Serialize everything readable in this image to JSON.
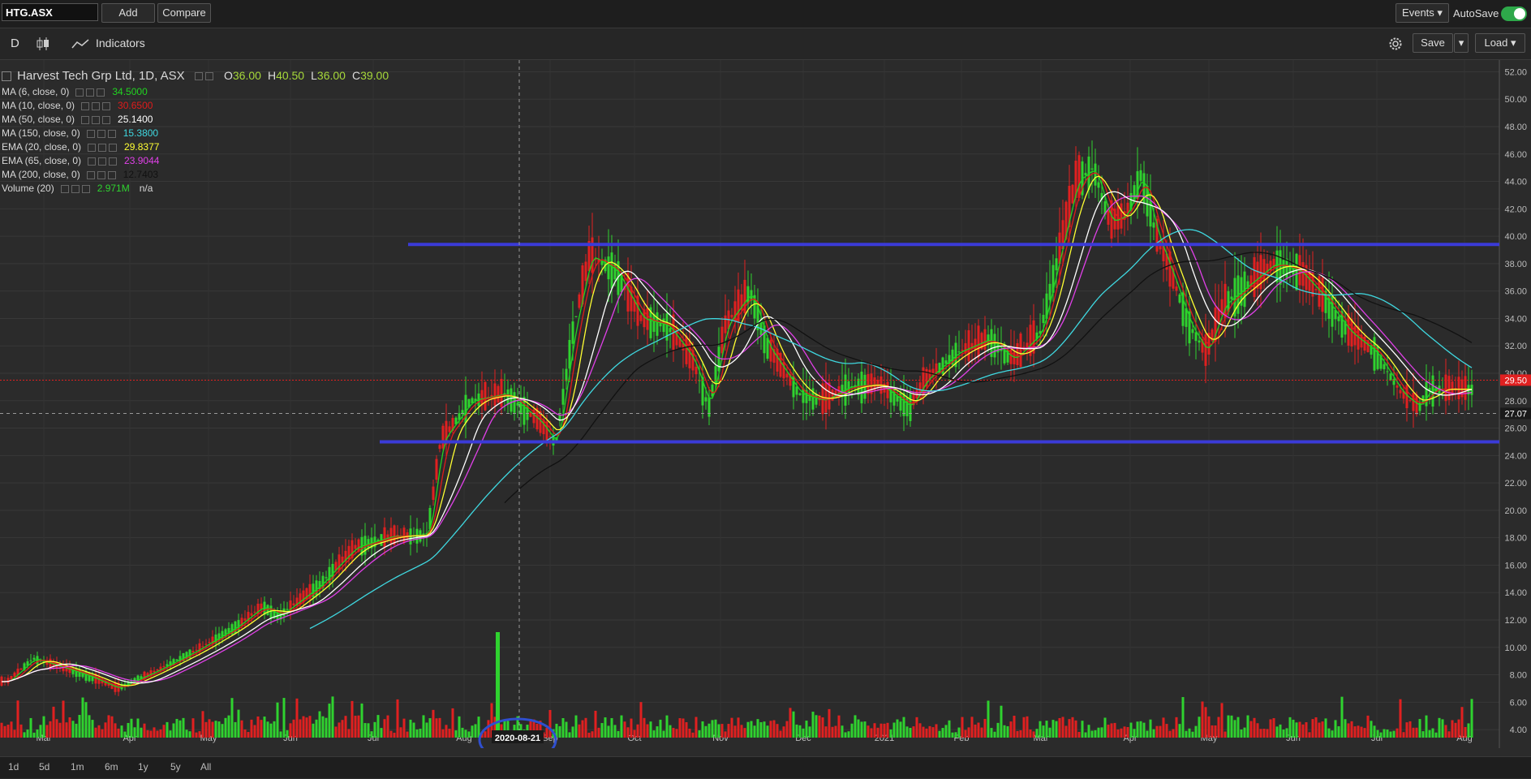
{
  "topbar": {
    "symbol": "HTG.ASX",
    "add_label": "Add",
    "compare_label": "Compare",
    "events_label": "Events ▾",
    "autosave_label": "AutoSave"
  },
  "toolbar": {
    "period_label": "D",
    "indicators_label": "Indicators",
    "save_label": "Save",
    "load_label": "Load ▾"
  },
  "legend": {
    "title": "Harvest Tech Grp Ltd, 1D, ASX",
    "ohlc": [
      {
        "label": "O",
        "value": "36.00"
      },
      {
        "label": "H",
        "value": "40.50"
      },
      {
        "label": "L",
        "value": "36.00"
      },
      {
        "label": "C",
        "value": "39.00"
      }
    ],
    "indicators": [
      {
        "label": "MA (6, close, 0)",
        "value": "34.5000",
        "color": "#21d321"
      },
      {
        "label": "MA (10, close, 0)",
        "value": "30.6500",
        "color": "#e01b1b"
      },
      {
        "label": "MA (50, close, 0)",
        "value": "25.1400",
        "color": "#ffffff"
      },
      {
        "label": "MA (150, close, 0)",
        "value": "15.3800",
        "color": "#3fd8e0"
      },
      {
        "label": "EMA (20, close, 0)",
        "value": "29.8377",
        "color": "#ffff33"
      },
      {
        "label": "EMA (65, close, 0)",
        "value": "23.9044",
        "color": "#e040e8"
      },
      {
        "label": "MA (200, close, 0)",
        "value": "12.7403",
        "color": "#111111"
      },
      {
        "label": "Volume (20)",
        "value": "2.971M",
        "extra": "n/a",
        "color": "#2fd22f"
      }
    ]
  },
  "chart_data": {
    "type": "candlestick",
    "title": "Harvest Tech Grp Ltd, 1D, ASX",
    "x_axis_labels": [
      "Mar",
      "Apr",
      "May",
      "Jun",
      "Jul",
      "Aug",
      "Sep",
      "Oct",
      "Nov",
      "Dec",
      "2021",
      "Feb",
      "Mar",
      "Apr",
      "May",
      "Jun",
      "Jul",
      "Aug"
    ],
    "crosshair_date": "2020-08-21",
    "y_ticks": [
      "52.00",
      "50.00",
      "48.00",
      "46.00",
      "44.00",
      "42.00",
      "40.00",
      "38.00",
      "36.00",
      "34.00",
      "32.00",
      "30.00",
      "28.00",
      "26.00",
      "24.00",
      "22.00",
      "20.00",
      "18.00",
      "16.00",
      "14.00",
      "12.00",
      "10.00",
      "8.00",
      "6.00",
      "4.00"
    ],
    "ylim": [
      3,
      52.5
    ],
    "last_price": "29.50",
    "crosshair_price": "27.07",
    "horizontal_lines": [
      39.4,
      25.0
    ],
    "price_path": [
      {
        "m": 0,
        "p": 7.5
      },
      {
        "m": 0.3,
        "p": 9.2
      },
      {
        "m": 0.9,
        "p": 8.0
      },
      {
        "m": 1.3,
        "p": 7.0
      },
      {
        "m": 1.8,
        "p": 8.3
      },
      {
        "m": 2.3,
        "p": 9.8
      },
      {
        "m": 2.8,
        "p": 11.6
      },
      {
        "m": 3.1,
        "p": 13.0
      },
      {
        "m": 3.3,
        "p": 12.3
      },
      {
        "m": 3.8,
        "p": 14.6
      },
      {
        "m": 4.2,
        "p": 17.3
      },
      {
        "m": 4.6,
        "p": 18.1
      },
      {
        "m": 5.0,
        "p": 18.2
      },
      {
        "m": 5.15,
        "p": 25.0
      },
      {
        "m": 5.5,
        "p": 28.0
      },
      {
        "m": 5.9,
        "p": 28.5
      },
      {
        "m": 6.3,
        "p": 26.5
      },
      {
        "m": 6.5,
        "p": 24.8
      },
      {
        "m": 6.7,
        "p": 33.0
      },
      {
        "m": 6.9,
        "p": 38.6
      },
      {
        "m": 7.2,
        "p": 37.5
      },
      {
        "m": 7.5,
        "p": 34.0
      },
      {
        "m": 7.8,
        "p": 33.5
      },
      {
        "m": 8.1,
        "p": 31.0
      },
      {
        "m": 8.3,
        "p": 27.5
      },
      {
        "m": 8.5,
        "p": 33.5
      },
      {
        "m": 8.8,
        "p": 36.0
      },
      {
        "m": 9.0,
        "p": 32.0
      },
      {
        "m": 9.4,
        "p": 28.5
      },
      {
        "m": 9.7,
        "p": 28.0
      },
      {
        "m": 10.0,
        "p": 29.0
      },
      {
        "m": 10.4,
        "p": 29.2
      },
      {
        "m": 10.8,
        "p": 27.5
      },
      {
        "m": 11.0,
        "p": 29.5
      },
      {
        "m": 11.4,
        "p": 31.5
      },
      {
        "m": 11.8,
        "p": 32.5
      },
      {
        "m": 12.1,
        "p": 31.0
      },
      {
        "m": 12.4,
        "p": 33.0
      },
      {
        "m": 12.6,
        "p": 38.5
      },
      {
        "m": 12.8,
        "p": 44.0
      },
      {
        "m": 13.0,
        "p": 45.0
      },
      {
        "m": 13.2,
        "p": 41.0
      },
      {
        "m": 13.4,
        "p": 41.5
      },
      {
        "m": 13.6,
        "p": 44.5
      },
      {
        "m": 13.8,
        "p": 40.0
      },
      {
        "m": 14.0,
        "p": 37.0
      },
      {
        "m": 14.2,
        "p": 33.5
      },
      {
        "m": 14.4,
        "p": 31.5
      },
      {
        "m": 14.6,
        "p": 35.0
      },
      {
        "m": 14.9,
        "p": 36.5
      },
      {
        "m": 15.2,
        "p": 38.0
      },
      {
        "m": 15.5,
        "p": 37.5
      },
      {
        "m": 15.8,
        "p": 35.5
      },
      {
        "m": 16.1,
        "p": 33.0
      },
      {
        "m": 16.4,
        "p": 31.5
      },
      {
        "m": 16.7,
        "p": 28.5
      },
      {
        "m": 16.9,
        "p": 27.5
      },
      {
        "m": 17.2,
        "p": 31.5
      },
      {
        "m": 17.5,
        "p": 32.0
      },
      {
        "m": 17.8,
        "p": 31.0
      },
      {
        "m": 18.0,
        "p": 30.5
      },
      {
        "m": 18.3,
        "p": 29.0
      },
      {
        "m": 18.6,
        "p": 30.5
      },
      {
        "m": 18.9,
        "p": 33.0
      },
      {
        "m": 19.0,
        "p": 37.0
      },
      {
        "m": 19.3,
        "p": 34.0
      },
      {
        "m": 19.7,
        "p": 33.5
      },
      {
        "m": 20.0,
        "p": 33.8
      },
      {
        "m": 20.3,
        "p": 32.5
      },
      {
        "m": 20.45,
        "p": 29.5
      }
    ],
    "volume_spike": {
      "date": "2020-08-21",
      "value": "15.0"
    }
  },
  "bottombar": {
    "ranges": [
      "1d",
      "5d",
      "1m",
      "6m",
      "1y",
      "5y",
      "All"
    ]
  }
}
